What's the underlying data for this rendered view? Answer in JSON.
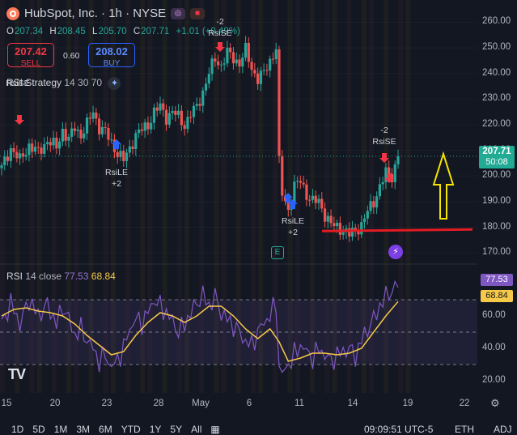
{
  "header": {
    "symbol": "HubSpot, Inc. · 1h · NYSE",
    "ohlc": [
      {
        "k": "O",
        "v": "207.34"
      },
      {
        "k": "H",
        "v": "208.45"
      },
      {
        "k": "L",
        "v": "205.70"
      },
      {
        "k": "C",
        "v": "207.71"
      }
    ],
    "change": "+1.01 (+0.49%)"
  },
  "trade": {
    "sell_price": "207.42",
    "sell_label": "SELL",
    "buy_price": "208.02",
    "buy_label": "BUY",
    "spread": "0.60"
  },
  "strategy_legend": {
    "name": "RSI Strategy",
    "params": "14 30 70"
  },
  "rsi_legend": {
    "name": "RSI",
    "params": "14 close",
    "v1": "77.53",
    "v2": "68.84"
  },
  "current": {
    "price": "207.71",
    "countdown": "50:08",
    "rsi": "77.53",
    "rsi_ma": "68.84"
  },
  "signals": [
    {
      "top": "-2",
      "label": "RsiSE"
    },
    {
      "top": "-2",
      "label": "RsiSE"
    },
    {
      "top": "-2",
      "label": "RsiSE"
    },
    {
      "label": "RsiLE",
      "bottom": "+2"
    },
    {
      "label": "RsiLE",
      "bottom": "+2"
    }
  ],
  "earnings_marker": "E",
  "bottom_bar": {
    "ranges": [
      "1D",
      "5D",
      "1M",
      "3M",
      "6M",
      "YTD",
      "1Y",
      "5Y",
      "All"
    ],
    "time": "09:09:51 UTC-5",
    "session": "ETH",
    "adj": "ADJ"
  },
  "colors": {
    "bg": "#131722",
    "up": "#26a69a",
    "down": "#ef5350",
    "rsi": "#7e57c2",
    "rsi_ma": "#f7c948",
    "support": "#e31b23",
    "arrow": "#f7e300"
  },
  "chart_data": [
    {
      "type": "candlestick",
      "title": "HubSpot, Inc. · 1h · NYSE",
      "x_tick_labels": [
        "15",
        "20",
        "23",
        "28",
        "May",
        "6",
        "11",
        "14",
        "19",
        "22"
      ],
      "y_tick_labels": [
        "170.00",
        "180.00",
        "190.00",
        "200.00",
        "210.00",
        "220.00",
        "230.00",
        "240.00",
        "250.00",
        "260.00"
      ],
      "ylim": [
        165,
        263
      ],
      "grid": true,
      "close_path": [
        [
          0,
          203
        ],
        [
          3,
          211
        ],
        [
          6,
          206
        ],
        [
          9,
          212
        ],
        [
          12,
          209
        ],
        [
          15,
          214
        ],
        [
          18,
          211
        ],
        [
          20,
          218
        ],
        [
          22,
          214
        ],
        [
          24,
          219
        ],
        [
          26,
          216
        ],
        [
          28,
          220
        ],
        [
          30,
          225
        ],
        [
          32,
          219
        ],
        [
          34,
          217
        ],
        [
          36,
          213
        ],
        [
          38,
          209
        ],
        [
          40,
          206
        ],
        [
          42,
          211
        ],
        [
          44,
          216
        ],
        [
          46,
          218
        ],
        [
          48,
          220
        ],
        [
          50,
          225
        ],
        [
          52,
          227
        ],
        [
          54,
          223
        ],
        [
          56,
          225
        ],
        [
          58,
          223
        ],
        [
          60,
          220
        ],
        [
          62,
          224
        ],
        [
          64,
          227
        ],
        [
          66,
          233
        ],
        [
          68,
          240
        ],
        [
          70,
          246
        ],
        [
          72,
          243
        ],
        [
          74,
          248
        ],
        [
          76,
          246
        ],
        [
          78,
          244
        ],
        [
          80,
          249
        ],
        [
          82,
          242
        ],
        [
          84,
          238
        ],
        [
          86,
          240
        ],
        [
          88,
          245
        ],
        [
          90,
          250
        ],
        [
          91,
          205
        ],
        [
          92,
          193
        ],
        [
          94,
          187
        ],
        [
          96,
          196
        ],
        [
          98,
          198
        ],
        [
          100,
          193
        ],
        [
          102,
          190
        ],
        [
          104,
          190
        ],
        [
          106,
          185
        ],
        [
          108,
          181
        ],
        [
          110,
          180
        ],
        [
          112,
          179
        ],
        [
          114,
          177
        ],
        [
          116,
          179
        ],
        [
          118,
          181
        ],
        [
          120,
          186
        ],
        [
          122,
          190
        ],
        [
          124,
          196
        ],
        [
          126,
          201
        ],
        [
          128,
          200
        ],
        [
          130,
          207.71
        ]
      ],
      "support_level": 178.5,
      "current_price": 207.71
    },
    {
      "type": "line",
      "title": "RSI 14 close",
      "y_tick_labels": [
        "20.00",
        "40.00",
        "60.00"
      ],
      "ylim": [
        15,
        85
      ],
      "bands": [
        30,
        70
      ],
      "series": [
        {
          "name": "RSI",
          "values": [
            [
              0,
              55
            ],
            [
              3,
              68
            ],
            [
              6,
              55
            ],
            [
              9,
              70
            ],
            [
              12,
              60
            ],
            [
              15,
              67
            ],
            [
              18,
              55
            ],
            [
              20,
              66
            ],
            [
              22,
              58
            ],
            [
              24,
              48
            ],
            [
              26,
              52
            ],
            [
              28,
              45
            ],
            [
              30,
              40
            ],
            [
              32,
              32
            ],
            [
              34,
              36
            ],
            [
              36,
              28
            ],
            [
              38,
              33
            ],
            [
              40,
              40
            ],
            [
              42,
              52
            ],
            [
              44,
              58
            ],
            [
              46,
              56
            ],
            [
              48,
              62
            ],
            [
              50,
              70
            ],
            [
              52,
              66
            ],
            [
              54,
              62
            ],
            [
              56,
              57
            ],
            [
              58,
              50
            ],
            [
              60,
              55
            ],
            [
              62,
              62
            ],
            [
              64,
              68
            ],
            [
              66,
              73
            ],
            [
              68,
              66
            ],
            [
              70,
              72
            ],
            [
              72,
              62
            ],
            [
              74,
              58
            ],
            [
              76,
              54
            ],
            [
              78,
              50
            ],
            [
              80,
              44
            ],
            [
              82,
              42
            ],
            [
              84,
              50
            ],
            [
              86,
              56
            ],
            [
              88,
              60
            ],
            [
              90,
              68
            ],
            [
              91,
              28
            ],
            [
              92,
              24
            ],
            [
              94,
              30
            ],
            [
              96,
              36
            ],
            [
              98,
              42
            ],
            [
              100,
              38
            ],
            [
              102,
              34
            ],
            [
              104,
              40
            ],
            [
              106,
              36
            ],
            [
              108,
              32
            ],
            [
              110,
              36
            ],
            [
              112,
              38
            ],
            [
              114,
              40
            ],
            [
              116,
              35
            ],
            [
              118,
              45
            ],
            [
              120,
              52
            ],
            [
              122,
              58
            ],
            [
              124,
              66
            ],
            [
              126,
              72
            ],
            [
              128,
              76
            ],
            [
              130,
              77.53
            ]
          ]
        },
        {
          "name": "MA",
          "values": [
            [
              0,
              60
            ],
            [
              4,
              64
            ],
            [
              8,
              65
            ],
            [
              12,
              63
            ],
            [
              16,
              62
            ],
            [
              20,
              60
            ],
            [
              24,
              55
            ],
            [
              28,
              48
            ],
            [
              32,
              42
            ],
            [
              36,
              36
            ],
            [
              40,
              38
            ],
            [
              44,
              48
            ],
            [
              48,
              56
            ],
            [
              52,
              62
            ],
            [
              56,
              60
            ],
            [
              60,
              56
            ],
            [
              64,
              60
            ],
            [
              68,
              66
            ],
            [
              72,
              66
            ],
            [
              76,
              60
            ],
            [
              80,
              52
            ],
            [
              84,
              46
            ],
            [
              88,
              52
            ],
            [
              91,
              44
            ],
            [
              94,
              32
            ],
            [
              98,
              34
            ],
            [
              102,
              37
            ],
            [
              106,
              37
            ],
            [
              110,
              36
            ],
            [
              114,
              37
            ],
            [
              118,
              40
            ],
            [
              122,
              50
            ],
            [
              126,
              60
            ],
            [
              130,
              68.84
            ]
          ]
        }
      ]
    }
  ]
}
